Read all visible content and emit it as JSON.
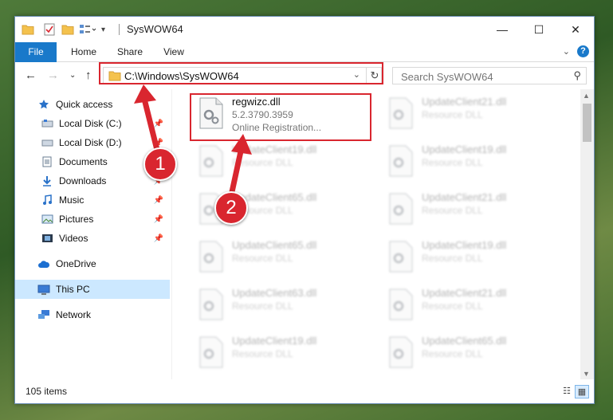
{
  "window": {
    "title": "SysWOW64",
    "controls": {
      "minimize": "—",
      "maximize": "☐",
      "close": "✕"
    }
  },
  "ribbon": {
    "tabs": [
      "File",
      "Home",
      "Share",
      "View"
    ],
    "help": "?"
  },
  "navigation": {
    "address": "C:\\Windows\\SysWOW64",
    "search_placeholder": "Search SysWOW64"
  },
  "sidebar": {
    "items": [
      {
        "label": "Quick access",
        "icon": "star-icon",
        "pinned": false
      },
      {
        "label": "Local Disk (C:)",
        "icon": "drive-icon",
        "pinned": true
      },
      {
        "label": "Local Disk (D:)",
        "icon": "drive-icon",
        "pinned": true
      },
      {
        "label": "Documents",
        "icon": "document-icon",
        "pinned": true
      },
      {
        "label": "Downloads",
        "icon": "download-icon",
        "pinned": true
      },
      {
        "label": "Music",
        "icon": "music-icon",
        "pinned": true
      },
      {
        "label": "Pictures",
        "icon": "pictures-icon",
        "pinned": true
      },
      {
        "label": "Videos",
        "icon": "video-icon",
        "pinned": true
      },
      {
        "label": "OneDrive",
        "icon": "cloud-icon",
        "pinned": false
      },
      {
        "label": "This PC",
        "icon": "computer-icon",
        "pinned": false,
        "selected": true
      },
      {
        "label": "Network",
        "icon": "network-icon",
        "pinned": false
      }
    ]
  },
  "files": [
    {
      "name": "regwizc.dll",
      "version": "5.2.3790.3959",
      "description": "Online Registration...",
      "highlighted": true
    },
    {
      "name": "UpdateClient21.dll",
      "description": "Resource DLL"
    },
    {
      "name": "UpdateClient19.dll",
      "description": "Resource DLL"
    },
    {
      "name": "UpdateClient19.dll",
      "description": "Resource DLL"
    },
    {
      "name": "UpdateClient65.dll",
      "description": "Resource DLL"
    },
    {
      "name": "UpdateClient21.dll",
      "description": "Resource DLL"
    },
    {
      "name": "UpdateClient65.dll",
      "description": "Resource DLL"
    },
    {
      "name": "UpdateClient19.dll",
      "description": "Resource DLL"
    },
    {
      "name": "UpdateClient63.dll",
      "description": "Resource DLL"
    },
    {
      "name": "UpdateClient21.dll",
      "description": "Resource DLL"
    },
    {
      "name": "UpdateClient19.dll",
      "description": "Resource DLL"
    },
    {
      "name": "UpdateClient65.dll",
      "description": "Resource DLL"
    }
  ],
  "status": {
    "item_count": "105 items"
  },
  "annotations": [
    {
      "number": "1",
      "color": "#d9262f"
    },
    {
      "number": "2",
      "color": "#d9262f"
    }
  ],
  "colors": {
    "accent": "#1979ca",
    "highlight_box": "#d9262f",
    "selected": "#cce8ff"
  }
}
